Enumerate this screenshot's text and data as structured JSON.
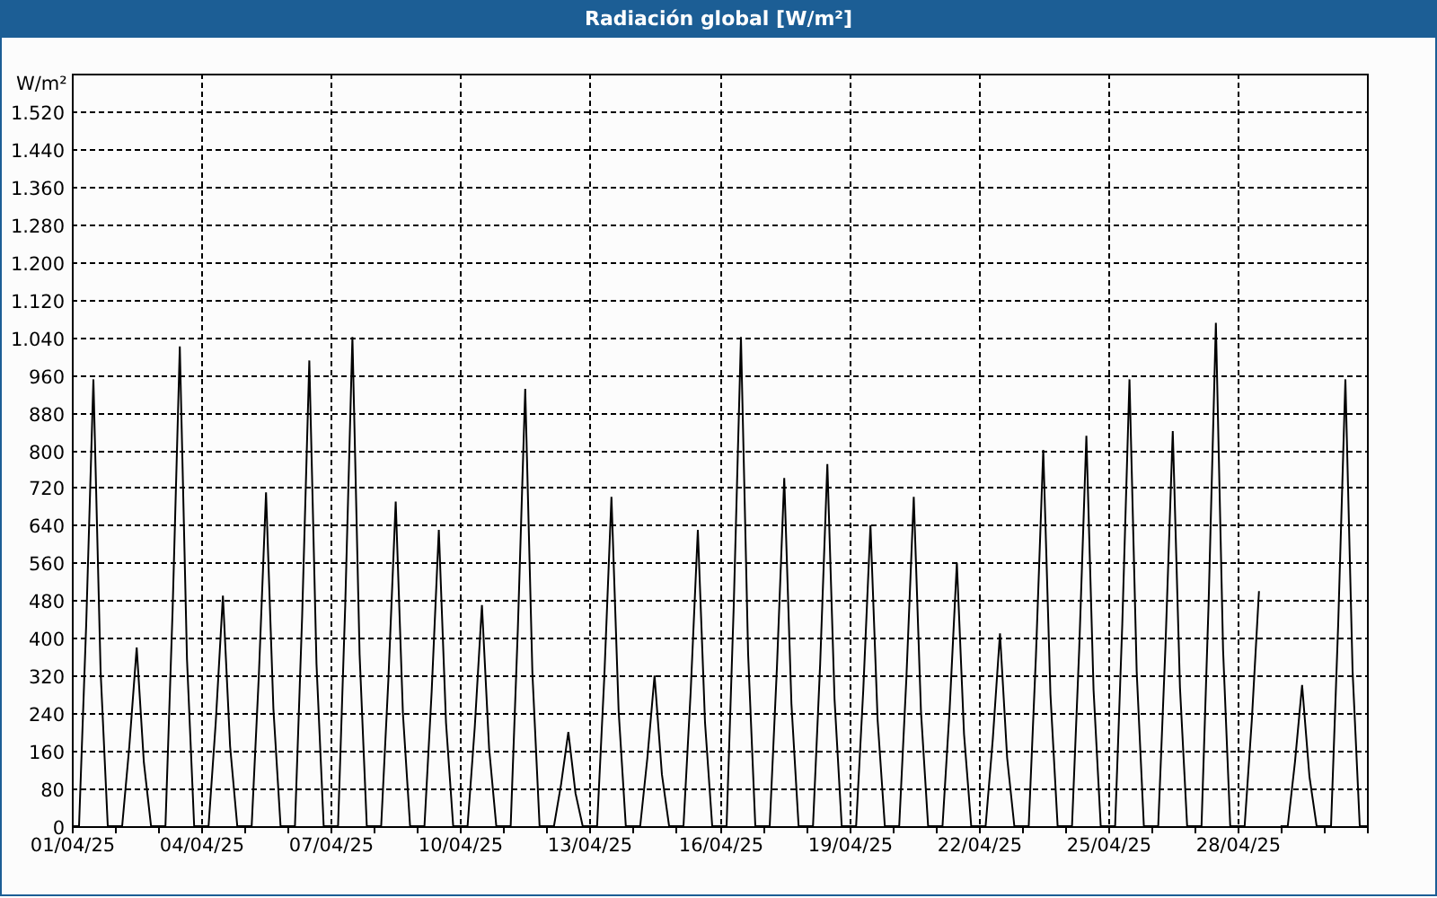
{
  "window": {
    "title": "Radiación global [W/m²]"
  },
  "chart_data": {
    "type": "line",
    "grid": true,
    "ylabel": "W/m²",
    "ylim": [
      0,
      1600
    ],
    "yticks": [
      {
        "value": 0,
        "label": "0"
      },
      {
        "value": 80,
        "label": "80"
      },
      {
        "value": 160,
        "label": "160"
      },
      {
        "value": 240,
        "label": "240"
      },
      {
        "value": 320,
        "label": "320"
      },
      {
        "value": 400,
        "label": "400"
      },
      {
        "value": 480,
        "label": "480"
      },
      {
        "value": 560,
        "label": "560"
      },
      {
        "value": 640,
        "label": "640"
      },
      {
        "value": 720,
        "label": "720"
      },
      {
        "value": 800,
        "label": "800"
      },
      {
        "value": 880,
        "label": "880"
      },
      {
        "value": 960,
        "label": "960"
      },
      {
        "value": 1040,
        "label": "1.040"
      },
      {
        "value": 1120,
        "label": "1.120"
      },
      {
        "value": 1200,
        "label": "1.200"
      },
      {
        "value": 1280,
        "label": "1.280"
      },
      {
        "value": 1360,
        "label": "1.360"
      },
      {
        "value": 1440,
        "label": "1.440"
      },
      {
        "value": 1520,
        "label": "1.520"
      }
    ],
    "categories": [
      "01/04/25",
      null,
      null,
      null,
      null,
      null,
      null,
      null,
      null,
      null,
      null,
      null,
      null,
      null,
      null,
      null,
      null,
      null,
      "04/04/25",
      null,
      null,
      null,
      null,
      null,
      null,
      null,
      null,
      null,
      null,
      null,
      null,
      null,
      null,
      null,
      null,
      null,
      "07/04/25",
      null,
      null,
      null,
      null,
      null,
      null,
      null,
      null,
      null,
      null,
      null,
      null,
      null,
      null,
      null,
      null,
      null,
      "10/04/25",
      null,
      null,
      null,
      null,
      null,
      null,
      null,
      null,
      null,
      null,
      null,
      null,
      null,
      null,
      null,
      null,
      null,
      "13/04/25",
      null,
      null,
      null,
      null,
      null,
      null,
      null,
      null,
      null,
      null,
      null,
      null,
      null,
      null,
      null,
      null,
      null,
      "16/04/25",
      null,
      null,
      null,
      null,
      null,
      null,
      null,
      null,
      null,
      null,
      null,
      null,
      null,
      null,
      null,
      null,
      null,
      "19/04/25",
      null,
      null,
      null,
      null,
      null,
      null,
      null,
      null,
      null,
      null,
      null,
      null,
      null,
      null,
      null,
      null,
      null,
      "22/04/25",
      null,
      null,
      null,
      null,
      null,
      null,
      null,
      null,
      null,
      null,
      null,
      null,
      null,
      null,
      null,
      null,
      null,
      "25/04/25",
      null,
      null,
      null,
      null,
      null,
      null,
      null,
      null,
      null,
      null,
      null,
      null,
      null,
      null,
      null,
      null,
      null,
      "28/04/25",
      null,
      null,
      null,
      null,
      null,
      null,
      null,
      null,
      null,
      null,
      null,
      null,
      null,
      null,
      null,
      null,
      null,
      null
    ],
    "series": [
      {
        "color": "#000000",
        "values": [
          0,
          0,
          430,
          950,
          330,
          0,
          0,
          0,
          170,
          380,
          135,
          0,
          0,
          0,
          460,
          1020,
          355,
          0,
          0,
          0,
          220,
          490,
          170,
          0,
          0,
          0,
          320,
          710,
          250,
          0,
          0,
          0,
          445,
          990,
          345,
          0,
          0,
          0,
          470,
          1040,
          365,
          0,
          0,
          0,
          310,
          690,
          240,
          0,
          0,
          0,
          285,
          630,
          220,
          0,
          0,
          0,
          210,
          470,
          165,
          0,
          0,
          0,
          420,
          930,
          325,
          0,
          0,
          0,
          90,
          200,
          70,
          0,
          0,
          0,
          315,
          700,
          245,
          0,
          0,
          0,
          145,
          320,
          110,
          0,
          0,
          0,
          285,
          630,
          220,
          0,
          0,
          0,
          470,
          1040,
          365,
          0,
          0,
          0,
          335,
          740,
          260,
          0,
          0,
          0,
          345,
          770,
          270,
          0,
          0,
          0,
          290,
          640,
          225,
          0,
          0,
          0,
          315,
          700,
          245,
          0,
          0,
          0,
          250,
          560,
          195,
          0,
          0,
          0,
          185,
          410,
          145,
          0,
          0,
          0,
          360,
          800,
          280,
          0,
          0,
          0,
          375,
          830,
          290,
          0,
          0,
          0,
          430,
          950,
          330,
          0,
          0,
          0,
          380,
          840,
          295,
          0,
          0,
          0,
          480,
          1070,
          375,
          0,
          0,
          0,
          225,
          500,
          null,
          null,
          0,
          0,
          135,
          300,
          105,
          0,
          0,
          0,
          430,
          950,
          330,
          0,
          0
        ]
      }
    ]
  }
}
